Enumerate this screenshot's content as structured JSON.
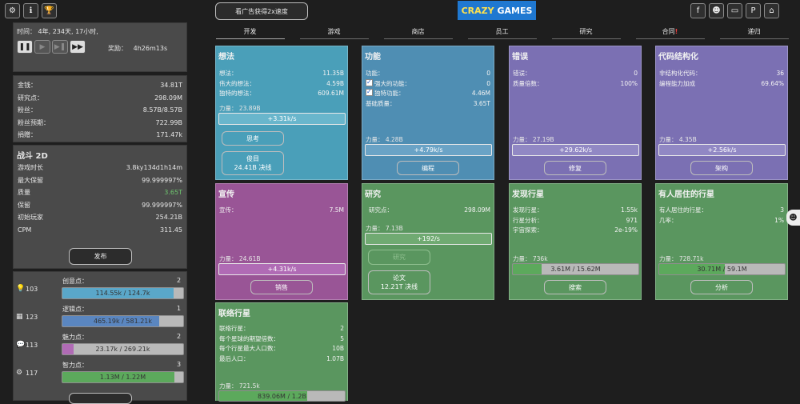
{
  "top": {
    "watch_ad": "看广告获得2x速度",
    "logo_part1": "CRAZY",
    "logo_part2": "GAMES",
    "tabs": [
      "开发",
      "游戏",
      "商店",
      "员工",
      "研究",
      "合同",
      "递归"
    ],
    "contract_badge": "!"
  },
  "time": {
    "label": "时间：",
    "value": "4年, 234天, 17小时,",
    "reward_label": "奖励：",
    "reward_value": "4h26m13s"
  },
  "stats": [
    {
      "label": "金钱：",
      "value": "34.81T"
    },
    {
      "label": "研究点：",
      "value": "298.09M"
    },
    {
      "label": "粉丝：",
      "value": "8.57B/8.57B"
    },
    {
      "label": "粉丝预期：",
      "value": "722.99B"
    },
    {
      "label": "捐赠：",
      "value": "171.47k"
    }
  ],
  "game": {
    "title": "战斗 2D",
    "rows": [
      {
        "label": "游戏时长",
        "value": "3.8ky134d1h14m"
      },
      {
        "label": "最大保留",
        "value": "99.999997%"
      },
      {
        "label": "质量",
        "value": "3.65T"
      },
      {
        "label": "保留",
        "value": "99.999997%"
      },
      {
        "label": "初始玩家",
        "value": "254.21B"
      },
      {
        "label": "CPM",
        "value": "311.45"
      }
    ],
    "publish": "发布"
  },
  "points": [
    {
      "icon": "lightbulb-icon",
      "count": "103",
      "label": "创意点：",
      "level": "2",
      "bar": "114.55k / 124.7k",
      "fill": 0.92,
      "color": "#5aa7c9"
    },
    {
      "icon": "calculator-icon",
      "count": "123",
      "label": "逻辑点：",
      "level": "1",
      "bar": "465.19k / 581.21k",
      "fill": 0.8,
      "color": "#5a86c0"
    },
    {
      "icon": "speech-bubble-icon",
      "count": "113",
      "label": "魅力点：",
      "level": "2",
      "bar": "23.17k / 269.21k",
      "fill": 0.09,
      "color": "#b06bb5"
    },
    {
      "icon": "gear-icon",
      "count": "117",
      "label": "智力点：",
      "level": "3",
      "bar": "1.13M / 1.22M",
      "fill": 0.93,
      "color": "#5ca95c"
    }
  ],
  "cards": {
    "ideas": {
      "title": "想法",
      "rows": [
        {
          "label": "想法：",
          "value": "11.35B"
        },
        {
          "label": "伟大的想法：",
          "value": "4.59B"
        },
        {
          "label": "独特的想法：",
          "value": "609.61M"
        }
      ],
      "power": "力量： 23.89B",
      "rate": "+3.31k/s",
      "btn1": "思考",
      "btn2a": "俊目",
      "btn2b": "24.41B 决线"
    },
    "features": {
      "title": "功能",
      "rows": [
        {
          "label": "功能：",
          "value": "0"
        },
        {
          "label": "强大的功能：",
          "value": "0"
        },
        {
          "label": "独特功能：",
          "value": "4.46M"
        },
        {
          "label": "基础质量：",
          "value": "3.65T"
        }
      ],
      "power": "力量： 4.28B",
      "rate": "+4.79k/s",
      "btn1": "编程"
    },
    "bugs": {
      "title": "错误",
      "rows": [
        {
          "label": "错误：",
          "value": "0"
        },
        {
          "label": "质量倍数：",
          "value": "100%"
        }
      ],
      "power": "力量： 27.19B",
      "rate": "+29.62k/s",
      "btn1": "修复"
    },
    "refactor": {
      "title": "代码结构化",
      "rows": [
        {
          "label": "非结构化代码：",
          "value": "36"
        },
        {
          "label": "编程能力加成",
          "value": "69.64%"
        }
      ],
      "power": "力量： 4.35B",
      "rate": "+2.56k/s",
      "btn1": "架构"
    },
    "promo": {
      "title": "宣传",
      "rows": [
        {
          "label": "宣传：",
          "value": "7.5M"
        }
      ],
      "power": "力量： 24.61B",
      "rate": "+4.31k/s",
      "btn1": "销售"
    },
    "research": {
      "title": "研究",
      "rows": [
        {
          "label": "研究点：",
          "value": "298.09M"
        }
      ],
      "power": "力量： 7.13B",
      "rate": "+192/s",
      "btn1": "研究",
      "btn2a": "论文",
      "btn2b": "12.21T 决线"
    },
    "discover": {
      "title": "发现行星",
      "rows": [
        {
          "label": "发现行星：",
          "value": "1.55k"
        },
        {
          "label": "行星分析：",
          "value": "971"
        },
        {
          "label": "宇宙探索：",
          "value": "2e-19%"
        }
      ],
      "power": "力量： 736k",
      "bar": "3.61M / 15.62M",
      "fill": 0.23,
      "btn1": "搜索"
    },
    "inhabited": {
      "title": "有人居住的行星",
      "rows": [
        {
          "label": "有人居住的行星：",
          "value": "3"
        },
        {
          "label": "几率：",
          "value": "1%"
        }
      ],
      "power": "力量： 728.71k",
      "bar": "30.71M / 59.1M",
      "fill": 0.52,
      "btn1": "分析"
    },
    "contact": {
      "title": "联络行星",
      "rows": [
        {
          "label": "联络行星：",
          "value": "2"
        },
        {
          "label": "每个星球的期望倍数：",
          "value": "5"
        },
        {
          "label": "每个行星最大人口数：",
          "value": "10B"
        },
        {
          "label": "最后人口：",
          "value": "1.07B"
        }
      ],
      "power": "力量： 721.5k",
      "bar": "839.06M / 1.2B",
      "fill": 0.7
    }
  },
  "colors": {
    "blue_card": "#4f8eb3",
    "teal_card": "#4a9fb9",
    "purple_card": "#7b70b3",
    "magenta_card": "#995596",
    "green_card": "#5a965f"
  }
}
